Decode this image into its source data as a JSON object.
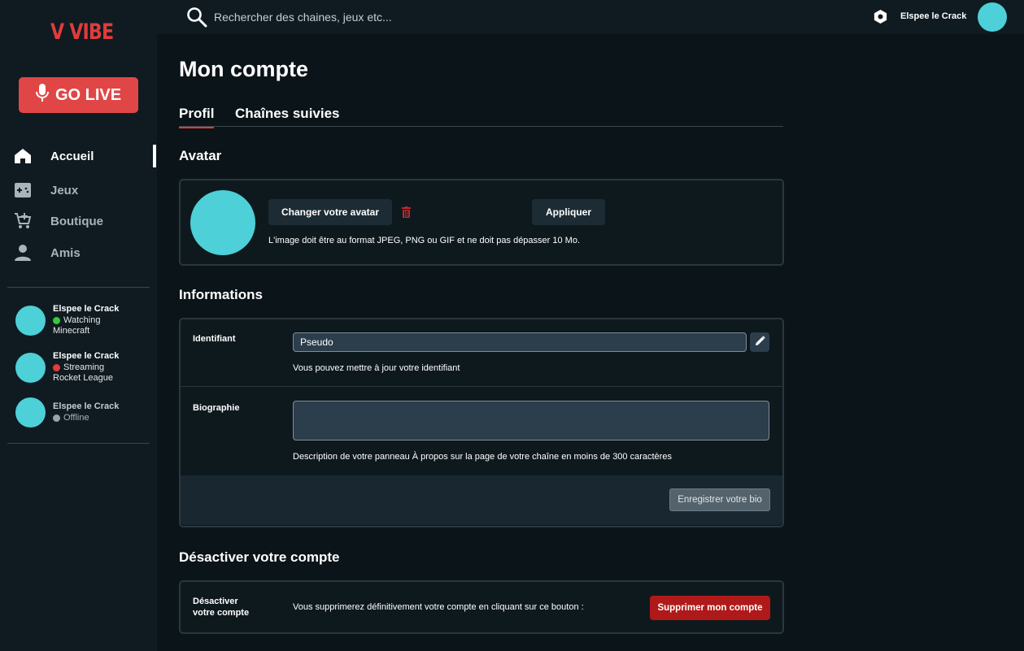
{
  "app": {
    "logo": "V VIBE"
  },
  "sidebar": {
    "go_live_label": "GO LIVE",
    "nav": [
      {
        "label": "Accueil",
        "icon": "home-icon",
        "active": true
      },
      {
        "label": "Jeux",
        "icon": "gamepad-icon",
        "active": false
      },
      {
        "label": "Boutique",
        "icon": "cart-icon",
        "active": false
      },
      {
        "label": "Amis",
        "icon": "person-icon",
        "active": false
      }
    ],
    "friends": [
      {
        "name": "Elspee le Crack",
        "status": "Watching",
        "status_color": "#36c93b",
        "game": "Minecraft"
      },
      {
        "name": "Elspee le Crack",
        "status": "Streaming",
        "status_color": "#e43c3c",
        "game": "Rocket League"
      },
      {
        "name": "Elspee le Crack",
        "status": "Offline",
        "status_color": "#9aa3a8",
        "game": ""
      }
    ]
  },
  "topbar": {
    "search_placeholder": "Rechercher des chaines, jeux etc...",
    "username": "Elspee le Crack"
  },
  "main": {
    "title": "Mon compte",
    "tabs": [
      {
        "label": "Profil",
        "active": true
      },
      {
        "label": "Chaînes suivies",
        "active": false
      }
    ],
    "avatar_section": {
      "title": "Avatar",
      "change_label": "Changer votre avatar",
      "apply_label": "Appliquer",
      "hint": "L'image doit être au format JPEG, PNG ou GIF et ne doit pas dépasser 10 Mo."
    },
    "info_section": {
      "title": "Informations",
      "identifier_label": "Identifiant",
      "identifier_value": "Pseudo",
      "identifier_hint": "Vous pouvez mettre à jour votre identifiant",
      "bio_label": "Biographie",
      "bio_value": "",
      "bio_hint": "Description de votre panneau À propos sur la page de votre chaîne en moins de 300 caractères",
      "save_bio_label": "Enregistrer votre bio"
    },
    "deactivate_section": {
      "title": "Désactiver votre compte",
      "row_label_line1": "Désactiver",
      "row_label_line2": "votre compte",
      "warning": "Vous supprimerez définitivement votre compte en cliquant sur ce bouton :",
      "delete_label": "Supprimer mon compte"
    }
  },
  "colors": {
    "accent_red": "#e04646",
    "avatar_teal": "#4dd0d8",
    "danger": "#b01919"
  }
}
